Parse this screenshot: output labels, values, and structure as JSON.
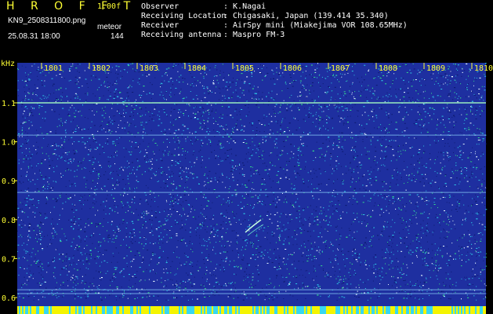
{
  "header": {
    "title": "H R O F F T",
    "version": "1.00f",
    "file_name": "KN9_2508311800.png",
    "mode_label": "meteor",
    "datetime": "25.08.31 18:00",
    "count": "144",
    "meta": [
      {
        "key": "Observer",
        "value": ": K.Nagai"
      },
      {
        "key": "Receiving Location",
        "value": ": Chigasaki, Japan (139.414 35.340)"
      },
      {
        "key": "Receiver",
        "value": ": AirSpy mini (Miakejima VOR 108.65MHz)"
      },
      {
        "key": "Receiving antenna",
        "value": ": Maspro FM-3"
      }
    ]
  },
  "spectrogram": {
    "unit": "kHz",
    "time_labels": [
      "1801",
      "1802",
      "1803",
      "1804",
      "1805",
      "1806",
      "1807",
      "1808",
      "1809",
      "1810"
    ],
    "freq_labels": [
      "1.1",
      "1.0",
      "0.9",
      "0.8",
      "0.7",
      "0.6"
    ],
    "freq_values": [
      1.1,
      1.0,
      0.9,
      0.8,
      0.7,
      0.6
    ],
    "horizontal_lines_khz": [
      1.1,
      1.017,
      0.87,
      0.62,
      0.61
    ],
    "colors": {
      "background": "#1e2fa0",
      "noise_dark": "#0d1a70",
      "noise_cyan": "#2ec8e6",
      "noise_green": "#36e08a",
      "noise_white": "#e8fbff",
      "axis_text": "#ffff33",
      "bottom_band_yellow": "#f4f400",
      "bottom_band_cyan": "#38d8f0"
    }
  }
}
